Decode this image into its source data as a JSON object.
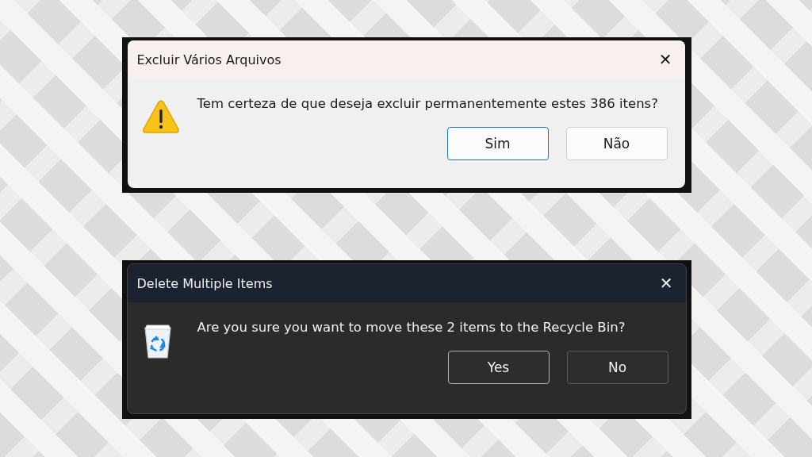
{
  "dialogs": [
    {
      "dark": false,
      "title": "Excluir Vários Arquivos",
      "close": "✕",
      "icon": {
        "kind": "warning"
      },
      "message": "Tem certeza de que deseja excluir permanentemente estes 386 itens?",
      "buttons": [
        {
          "label": "Sim",
          "default": true
        },
        {
          "label": "Não",
          "default": false
        }
      ]
    },
    {
      "dark": true,
      "title": "Delete Multiple Items",
      "close": "✕",
      "icon": {
        "kind": "recycle-bin"
      },
      "message": "Are you sure you want to move these 2 items to the Recycle Bin?",
      "buttons": [
        {
          "label": "Yes",
          "default": true
        },
        {
          "label": "No",
          "default": false
        }
      ]
    }
  ]
}
